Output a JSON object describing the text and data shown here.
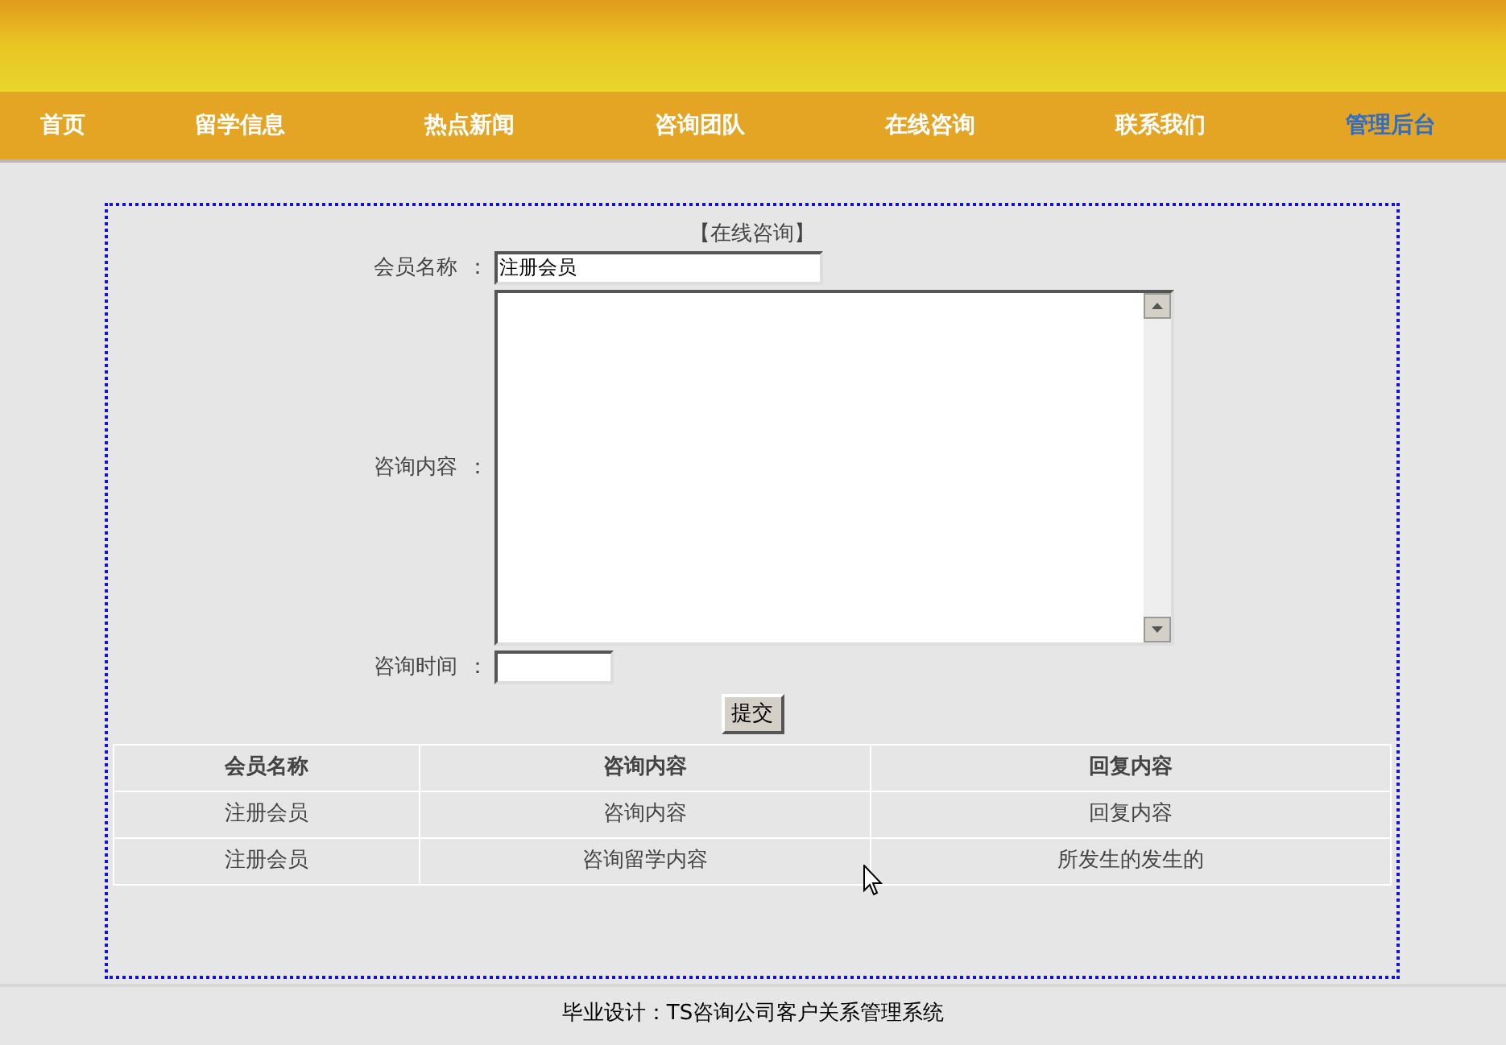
{
  "nav": [
    {
      "label": "首页",
      "selected": false
    },
    {
      "label": "留学信息",
      "selected": false
    },
    {
      "label": "热点新闻",
      "selected": false
    },
    {
      "label": "咨询团队",
      "selected": false
    },
    {
      "label": "在线咨询",
      "selected": false
    },
    {
      "label": "联系我们",
      "selected": false
    },
    {
      "label": "管理后台",
      "selected": true
    }
  ],
  "form": {
    "title": "【在线咨询】",
    "name_label": "会员名称",
    "name_colon": "：",
    "name_value": "注册会员",
    "content_label": "咨询内容",
    "content_colon": "：",
    "time_label": "咨询时间",
    "time_colon": "：",
    "submit": "提交"
  },
  "table": {
    "columns": [
      "会员名称",
      "咨询内容",
      "回复内容"
    ],
    "rows": [
      [
        "注册会员",
        "咨询内容",
        "回复内容"
      ],
      [
        "注册会员",
        "咨询留学内容",
        "所发生的发生的"
      ]
    ]
  },
  "footer": "毕业设计：TS咨询公司客户关系管理系统"
}
